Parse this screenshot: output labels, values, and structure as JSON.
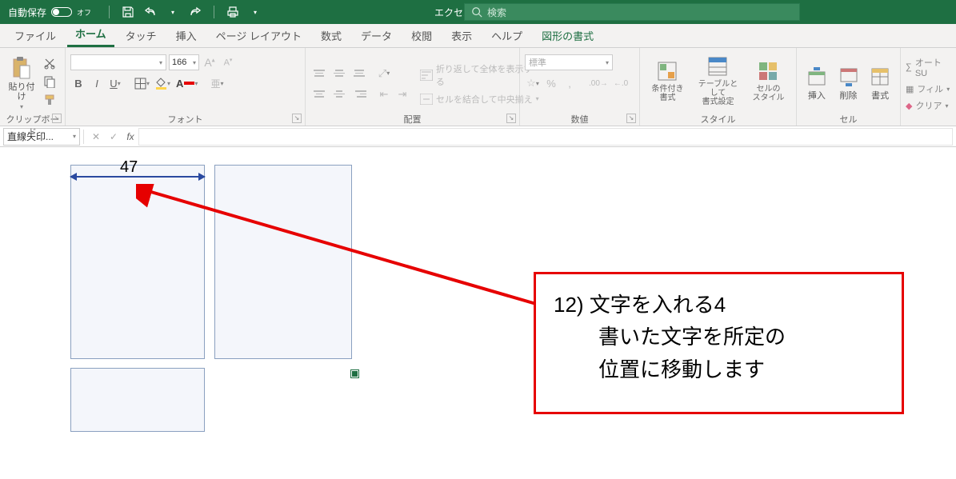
{
  "titlebar": {
    "autosave_label": "自動保存",
    "autosave_state": "オフ",
    "document_title": "エクセルで裁断図",
    "search_placeholder": "検索"
  },
  "tabs": {
    "file": "ファイル",
    "home": "ホーム",
    "touch": "タッチ",
    "insert": "挿入",
    "pagelayout": "ページ レイアウト",
    "formulas": "数式",
    "data": "データ",
    "review": "校閲",
    "view": "表示",
    "help": "ヘルプ",
    "shapeformat": "図形の書式"
  },
  "ribbon": {
    "clipboard": {
      "paste": "貼り付け",
      "group": "クリップボード"
    },
    "font": {
      "size": "166",
      "increase": "A",
      "decrease": "A",
      "bold": "B",
      "italic": "I",
      "underline": "U",
      "group": "フォント"
    },
    "alignment": {
      "wrap": "折り返して全体を表示する",
      "merge": "セルを結合して中央揃え",
      "group": "配置"
    },
    "number": {
      "format": "標準",
      "group": "数値"
    },
    "styles": {
      "conditional": "条件付き\n書式",
      "table": "テーブルとして\n書式設定",
      "cell": "セルの\nスタイル",
      "group": "スタイル"
    },
    "cells": {
      "insert": "挿入",
      "delete": "削除",
      "format": "書式",
      "group": "セル"
    },
    "editing": {
      "autosum": "オート SU",
      "fill": "フィル",
      "clear": "クリア"
    }
  },
  "formula_bar": {
    "name": "直線矢印...",
    "fx": "fx"
  },
  "canvas": {
    "dimension_value": "47",
    "callout_line1": "12) 文字を入れる4",
    "callout_line2": "書いた文字を所定の",
    "callout_line3": "位置に移動します"
  }
}
